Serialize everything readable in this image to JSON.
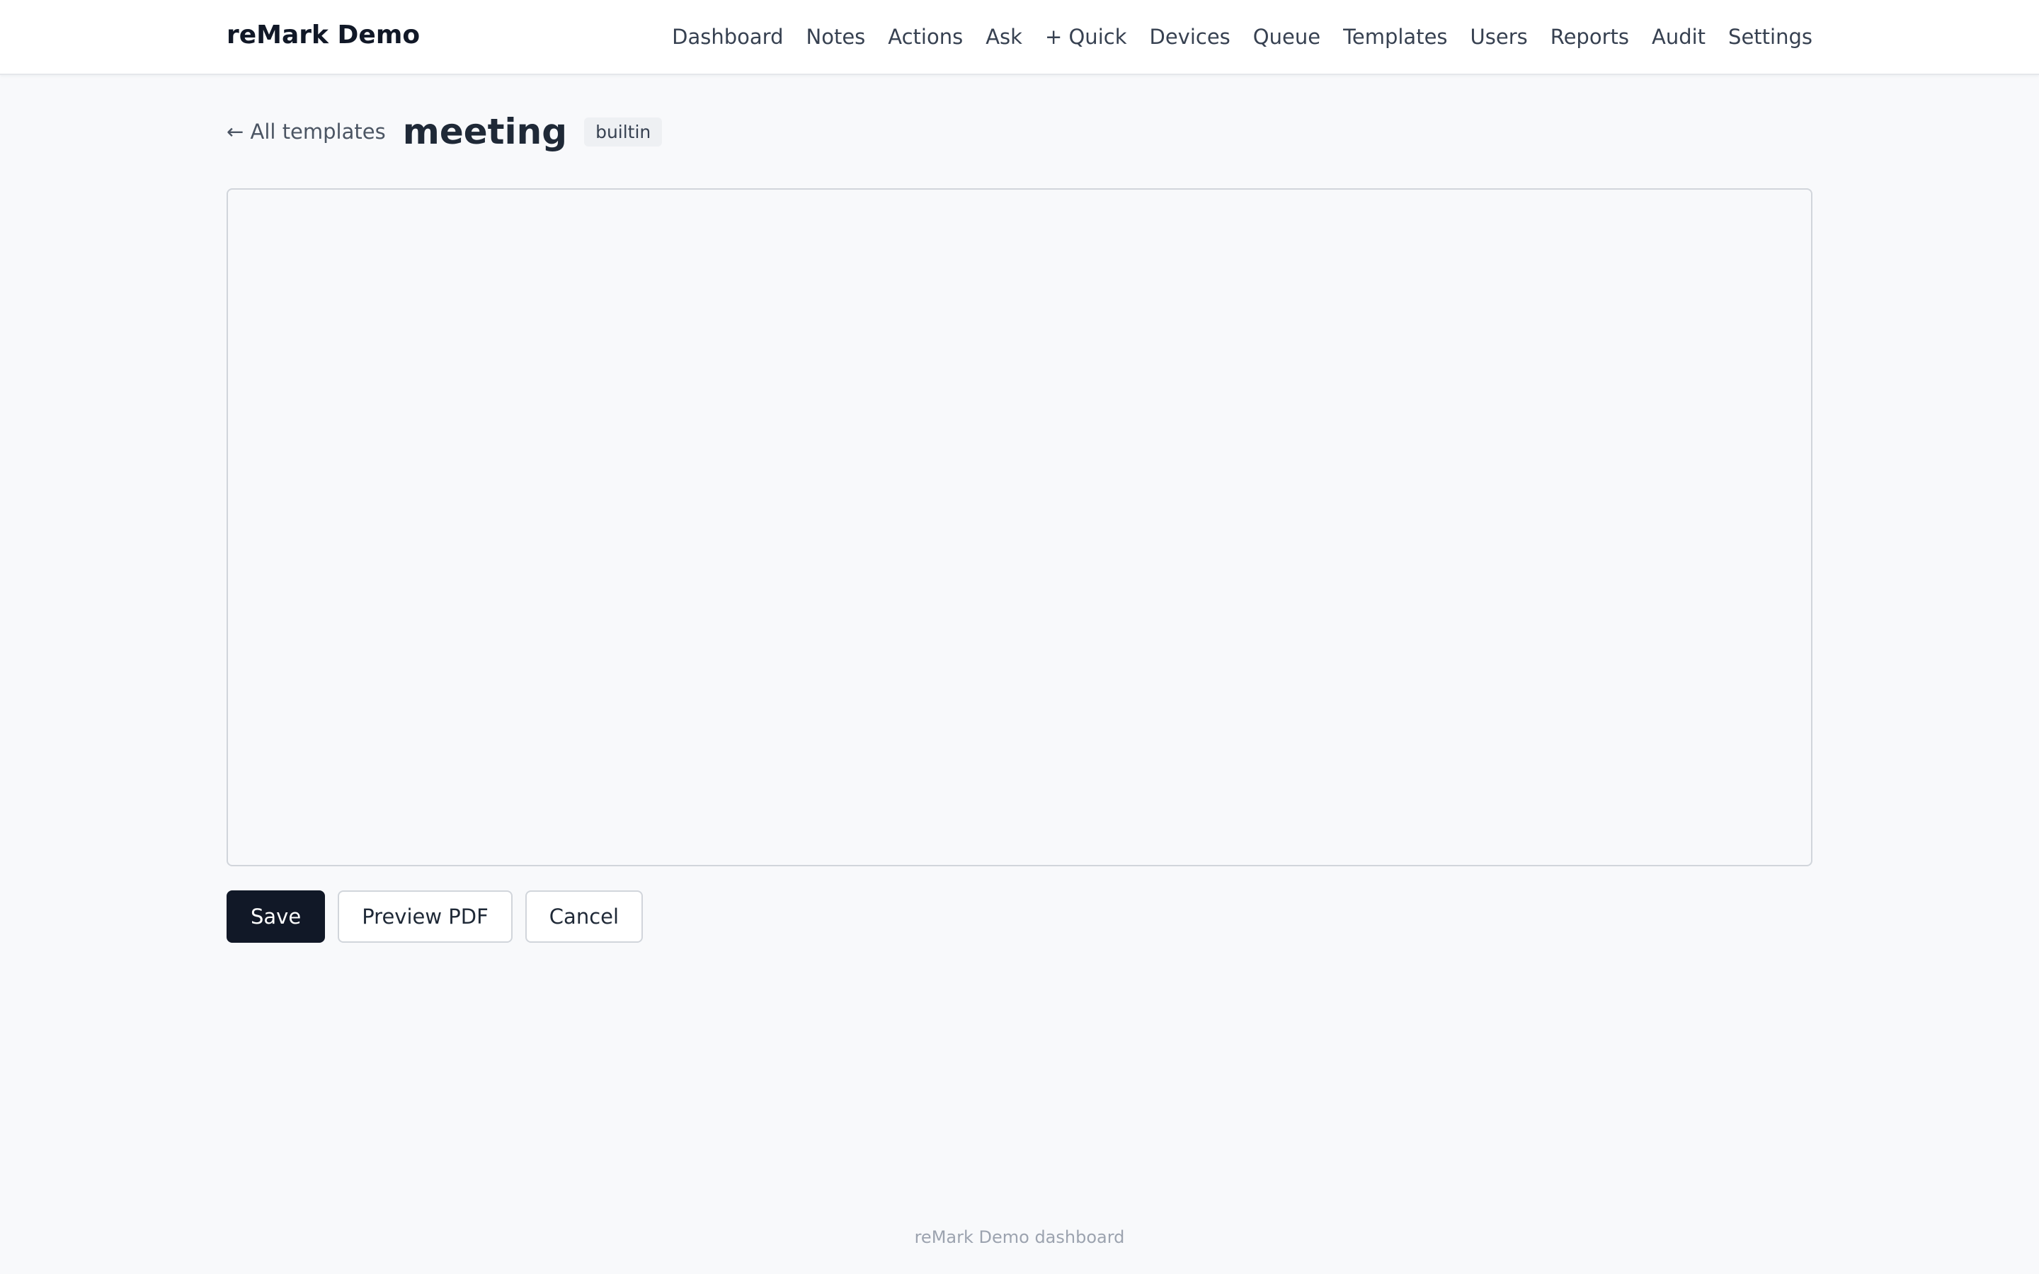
{
  "app": {
    "brand": "reMark Demo"
  },
  "nav": {
    "items": [
      "Dashboard",
      "Notes",
      "Actions",
      "Ask",
      "+ Quick",
      "Devices",
      "Queue",
      "Templates",
      "Users",
      "Reports",
      "Audit",
      "Settings"
    ]
  },
  "header": {
    "back_label": "← All templates",
    "title": "meeting",
    "badge": "builtin"
  },
  "editor": {
    "value": ""
  },
  "actions": {
    "save_label": "Save",
    "preview_label": "Preview PDF",
    "cancel_label": "Cancel"
  },
  "footer": {
    "text": "reMark Demo dashboard"
  },
  "colors": {
    "primary": "#111827",
    "background": "#f8f9fb",
    "border": "#d1d5db"
  }
}
